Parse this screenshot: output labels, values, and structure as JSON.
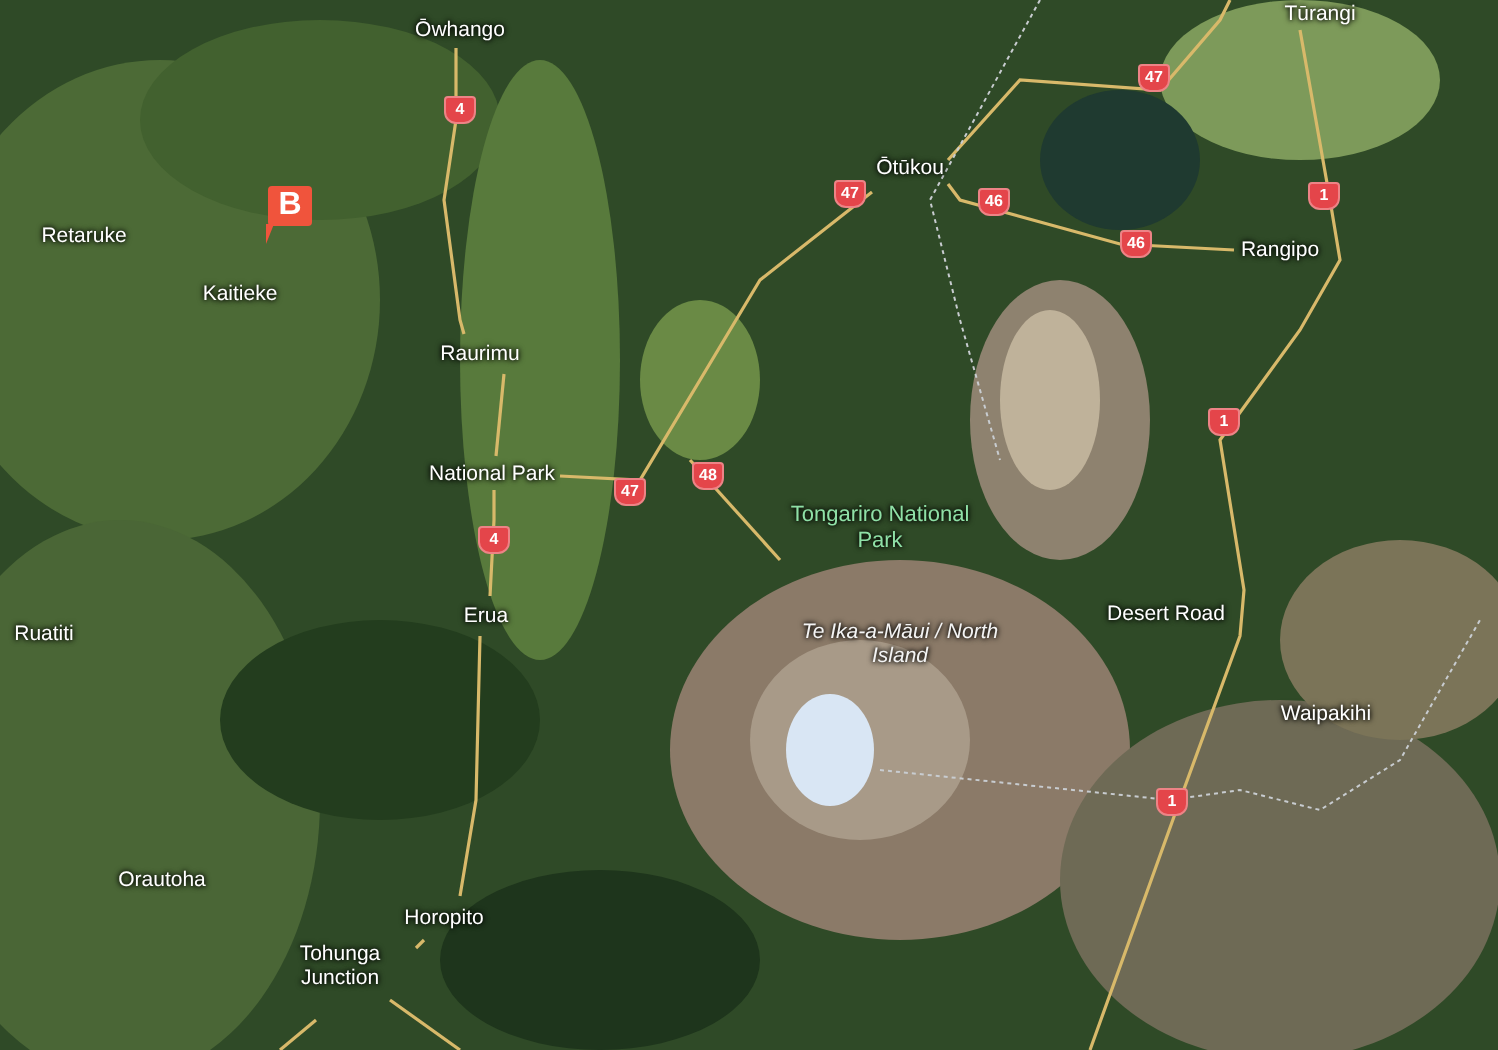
{
  "map": {
    "marker": {
      "label": "B"
    },
    "labels": [
      {
        "text": "Ōwhango",
        "kind": "place"
      },
      {
        "text": "Retaruke",
        "kind": "place"
      },
      {
        "text": "Kaitieke",
        "kind": "place"
      },
      {
        "text": "Raurimu",
        "kind": "place"
      },
      {
        "text": "National Park",
        "kind": "place"
      },
      {
        "text": "Erua",
        "kind": "place"
      },
      {
        "text": "Ruatiti",
        "kind": "place"
      },
      {
        "text": "Orautoha",
        "kind": "place"
      },
      {
        "text": "Horopito",
        "kind": "place"
      },
      {
        "text": "Tohunga Junction",
        "kind": "place"
      },
      {
        "text": "Ōtūkou",
        "kind": "place"
      },
      {
        "text": "Tūrangi",
        "kind": "place"
      },
      {
        "text": "Rangipo",
        "kind": "place"
      },
      {
        "text": "Desert Road",
        "kind": "place"
      },
      {
        "text": "Waipakihi",
        "kind": "place"
      },
      {
        "text": "Tongariro National Park",
        "kind": "park"
      },
      {
        "text": "Te Ika-a-Māui / North Island",
        "kind": "region"
      }
    ],
    "road_shields": [
      "4",
      "47",
      "47",
      "47",
      "46",
      "46",
      "48",
      "4",
      "1",
      "1",
      "1"
    ]
  }
}
